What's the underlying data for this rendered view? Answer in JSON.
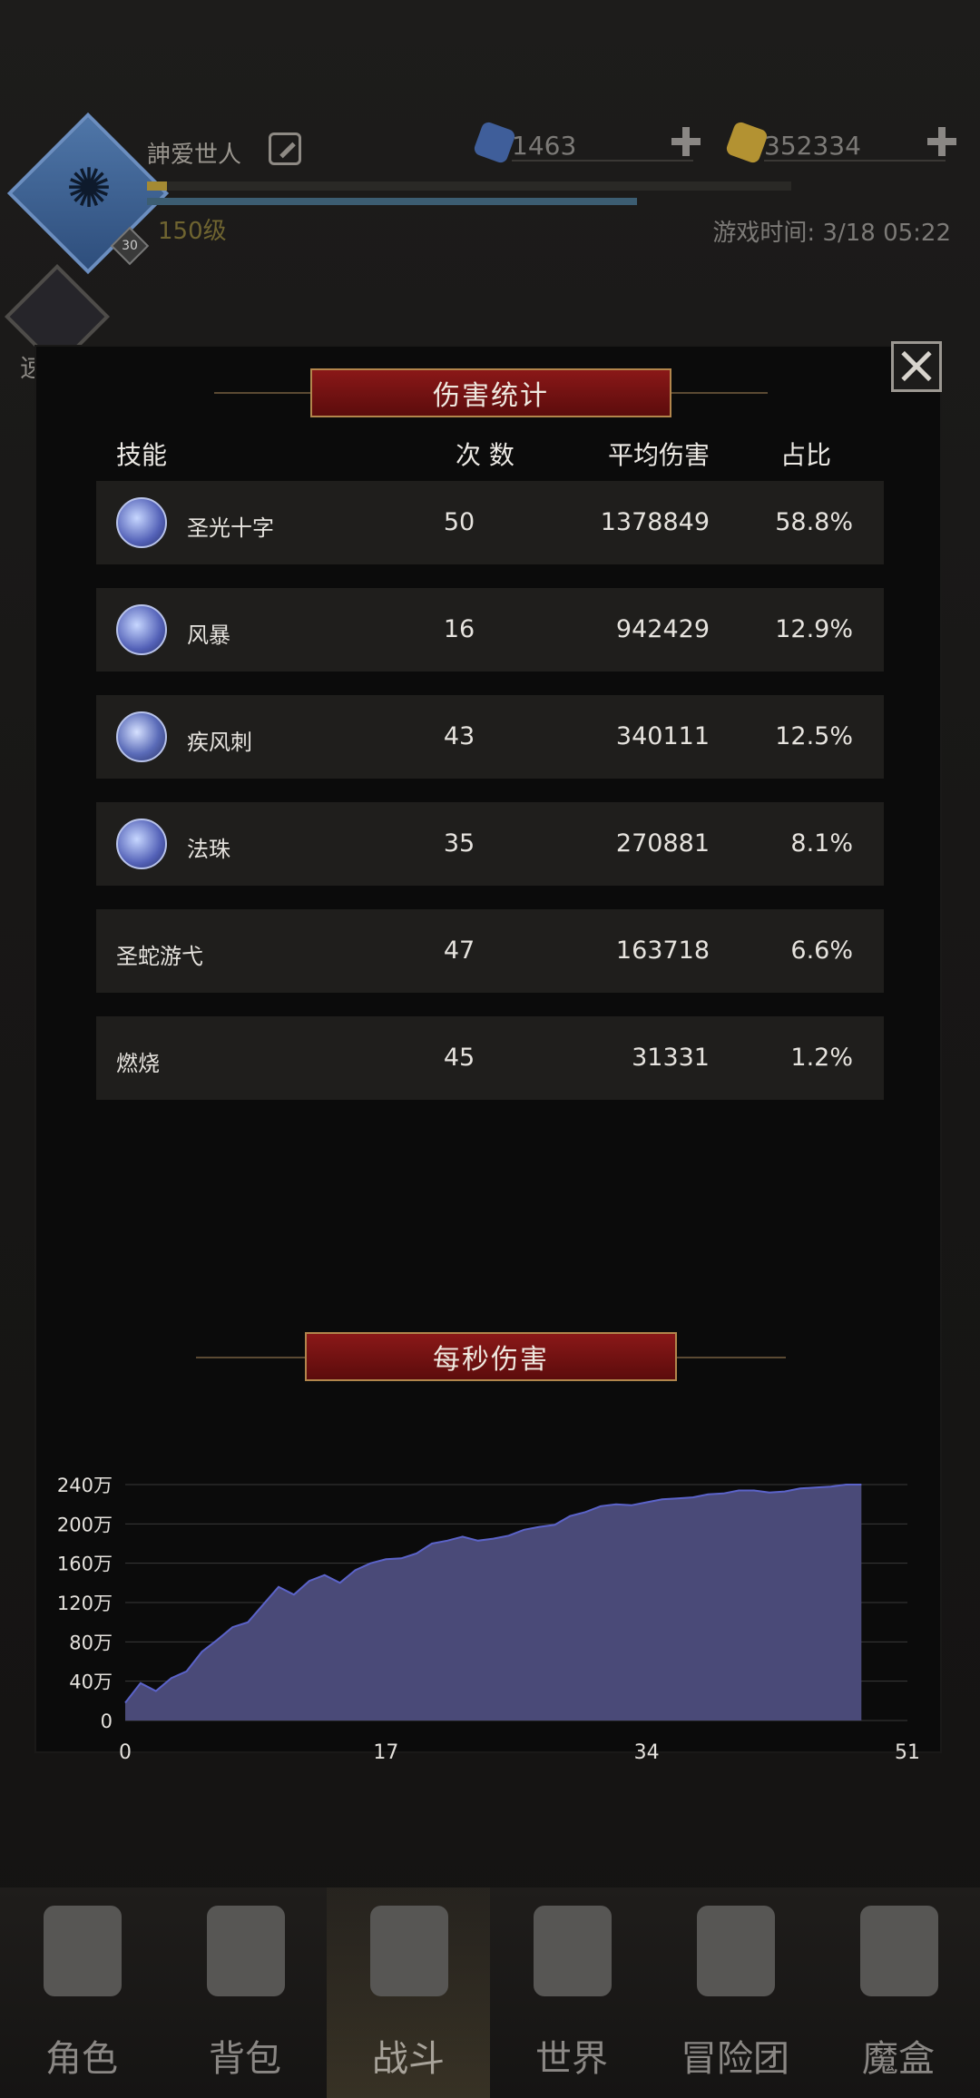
{
  "header": {
    "player_name": "訷爱世人",
    "player_level": "150级",
    "avatar_badge": "30",
    "gems": "1463",
    "gold": "352334",
    "game_time": "游戏时间: 3/18 05:22",
    "quick_battle_label": "速战"
  },
  "dialog": {
    "title": "伤害统计",
    "columns": {
      "skill": "技能",
      "count": "次 数",
      "avg": "平均伤害",
      "share": "占比"
    },
    "rows": [
      {
        "name": "圣光十字",
        "count": "50",
        "avg": "1378849",
        "share": "58.8%",
        "icon": "holy-cross-icon"
      },
      {
        "name": "风暴",
        "count": "16",
        "avg": "942429",
        "share": "12.9%",
        "icon": "storm-icon"
      },
      {
        "name": "疾风刺",
        "count": "43",
        "avg": "340111",
        "share": "12.5%",
        "icon": "gale-thrust-icon"
      },
      {
        "name": "法珠",
        "count": "35",
        "avg": "270881",
        "share": "8.1%",
        "icon": "magic-orb-icon"
      },
      {
        "name": "圣蛇游弋",
        "count": "47",
        "avg": "163718",
        "share": "6.6%",
        "icon": ""
      },
      {
        "name": "燃烧",
        "count": "45",
        "avg": "31331",
        "share": "1.2%",
        "icon": ""
      }
    ],
    "dps_title": "每秒伤害"
  },
  "chart_data": {
    "type": "area",
    "title": "每秒伤害",
    "xlabel": "",
    "ylabel": "",
    "xlim": [
      0,
      51
    ],
    "ylim": [
      0,
      2400000
    ],
    "x_ticks": [
      "0",
      "17",
      "34",
      "51"
    ],
    "y_ticks": [
      "0",
      "40万",
      "80万",
      "120万",
      "160万",
      "200万",
      "240万"
    ],
    "grid": true,
    "color": "#4a4a78",
    "x": [
      0,
      1,
      2,
      3,
      4,
      5,
      6,
      7,
      8,
      9,
      10,
      11,
      12,
      13,
      14,
      15,
      16,
      17,
      18,
      19,
      20,
      21,
      22,
      23,
      24,
      25,
      26,
      27,
      28,
      29,
      30,
      31,
      32,
      33,
      34,
      35,
      36,
      37,
      38,
      39,
      40,
      41,
      42,
      43,
      44,
      45,
      46,
      47,
      48
    ],
    "values": [
      180000,
      380000,
      300000,
      430000,
      500000,
      700000,
      820000,
      950000,
      1000000,
      1180000,
      1360000,
      1280000,
      1420000,
      1480000,
      1400000,
      1530000,
      1600000,
      1640000,
      1650000,
      1700000,
      1800000,
      1830000,
      1870000,
      1830000,
      1850000,
      1880000,
      1940000,
      1970000,
      1990000,
      2080000,
      2120000,
      2180000,
      2200000,
      2190000,
      2220000,
      2250000,
      2260000,
      2270000,
      2300000,
      2310000,
      2340000,
      2340000,
      2320000,
      2330000,
      2360000,
      2370000,
      2380000,
      2400000,
      2400000
    ]
  },
  "nav": [
    {
      "label": "角色",
      "icon": "helmet-icon"
    },
    {
      "label": "背包",
      "icon": "backpack-icon"
    },
    {
      "label": "战斗",
      "icon": "sword-shield-icon"
    },
    {
      "label": "世界",
      "icon": "world-map-icon"
    },
    {
      "label": "冒险团",
      "icon": "castle-icon"
    },
    {
      "label": "魔盒",
      "icon": "magic-box-icon"
    }
  ]
}
